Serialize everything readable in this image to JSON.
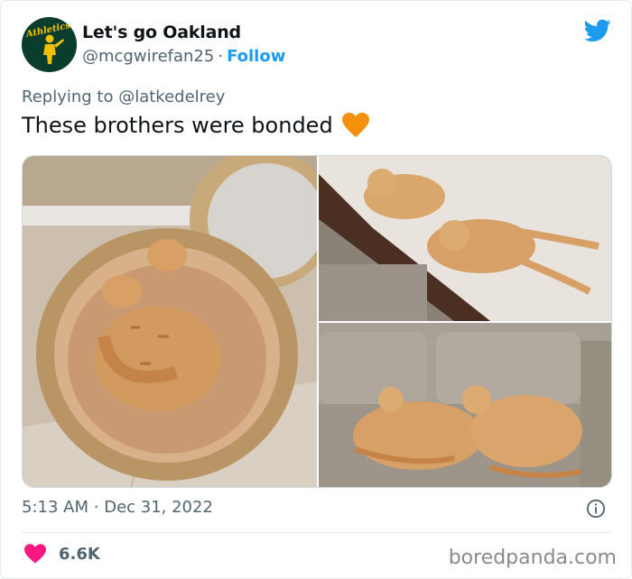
{
  "user": {
    "display_name": "Let's go Oakland",
    "handle": "@mcgwirefan25",
    "separator": "·",
    "follow_label": "Follow",
    "avatar_text": "Athletics"
  },
  "reply": {
    "prefix": "Replying to",
    "mention": "@latkedelrey"
  },
  "tweet": {
    "text": "These brothers were bonded",
    "emoji": "orange-heart"
  },
  "media": {
    "photos": [
      "two orange cats curled in a wicker basket",
      "two orange cats lying on a bed",
      "two orange cats sleeping on a couch"
    ]
  },
  "meta": {
    "time": "5:13 AM",
    "separator": "·",
    "date": "Dec 31, 2022"
  },
  "engagement": {
    "likes": "6.6K"
  },
  "watermark": "boredpanda.com",
  "colors": {
    "twitter_blue": "#1d9bf0",
    "like_red": "#f91880",
    "orange_heart": "#f4900c",
    "muted": "#536471"
  }
}
